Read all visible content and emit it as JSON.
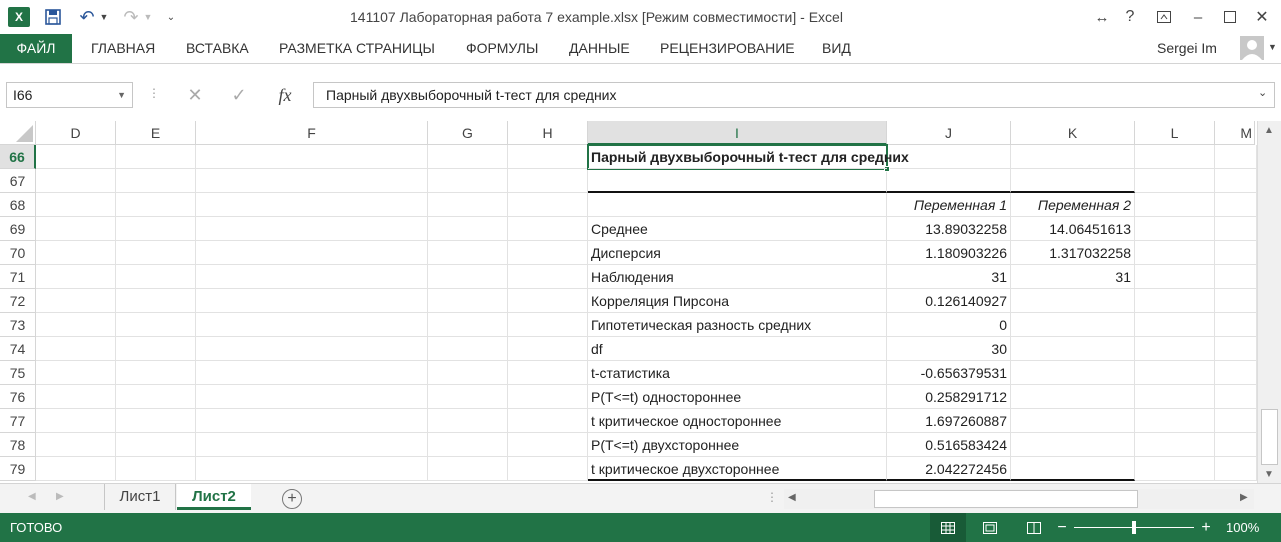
{
  "window": {
    "title": "141107 Лабораторная работа 7 example.xlsx  [Режим совместимости] - Excel",
    "user": "Sergei Im",
    "help": "?"
  },
  "ribbon": {
    "tabs": [
      "ФАЙЛ",
      "ГЛАВНАЯ",
      "ВСТАВКА",
      "РАЗМЕТКА СТРАНИЦЫ",
      "ФОРМУЛЫ",
      "ДАННЫЕ",
      "РЕЦЕНЗИРОВАНИЕ",
      "ВИД"
    ]
  },
  "formula_bar": {
    "name_box": "I66",
    "fx": "fx",
    "content": "Парный двухвыборочный t-тест для средних"
  },
  "columns": [
    "D",
    "E",
    "F",
    "G",
    "H",
    "I",
    "J",
    "K",
    "L",
    "M"
  ],
  "selected_column": "I",
  "rows": [
    "66",
    "67",
    "68",
    "69",
    "70",
    "71",
    "72",
    "73",
    "74",
    "75",
    "76",
    "77",
    "78",
    "79"
  ],
  "selected_row": "66",
  "table": {
    "title": "Парный двухвыборочный t-тест для средних",
    "headers": [
      "Переменная 1",
      "Переменная 2"
    ],
    "rows": [
      {
        "label": "Среднее",
        "v1": "13.89032258",
        "v2": "14.06451613"
      },
      {
        "label": "Дисперсия",
        "v1": "1.180903226",
        "v2": "1.317032258"
      },
      {
        "label": "Наблюдения",
        "v1": "31",
        "v2": "31"
      },
      {
        "label": "Корреляция Пирсона",
        "v1": "0.126140927",
        "v2": ""
      },
      {
        "label": "Гипотетическая разность средних",
        "v1": "0",
        "v2": ""
      },
      {
        "label": "df",
        "v1": "30",
        "v2": ""
      },
      {
        "label": "t-статистика",
        "v1": "-0.656379531",
        "v2": ""
      },
      {
        "label": "P(T<=t) одностороннее",
        "v1": "0.258291712",
        "v2": ""
      },
      {
        "label": "t критическое одностороннее",
        "v1": "1.697260887",
        "v2": ""
      },
      {
        "label": "P(T<=t) двухстороннее",
        "v1": "0.516583424",
        "v2": ""
      },
      {
        "label": "t критическое двухстороннее",
        "v1": "2.042272456",
        "v2": ""
      }
    ]
  },
  "sheets": {
    "tabs": [
      "Лист1",
      "Лист2"
    ],
    "active": "Лист2"
  },
  "status": {
    "ready": "ГОТОВО",
    "zoom": "100%",
    "zoom_level_percent": 100
  },
  "colors": {
    "accent": "#217346",
    "header_selected_bg": "#e1e1e1",
    "gridline": "#e2e2e2"
  }
}
